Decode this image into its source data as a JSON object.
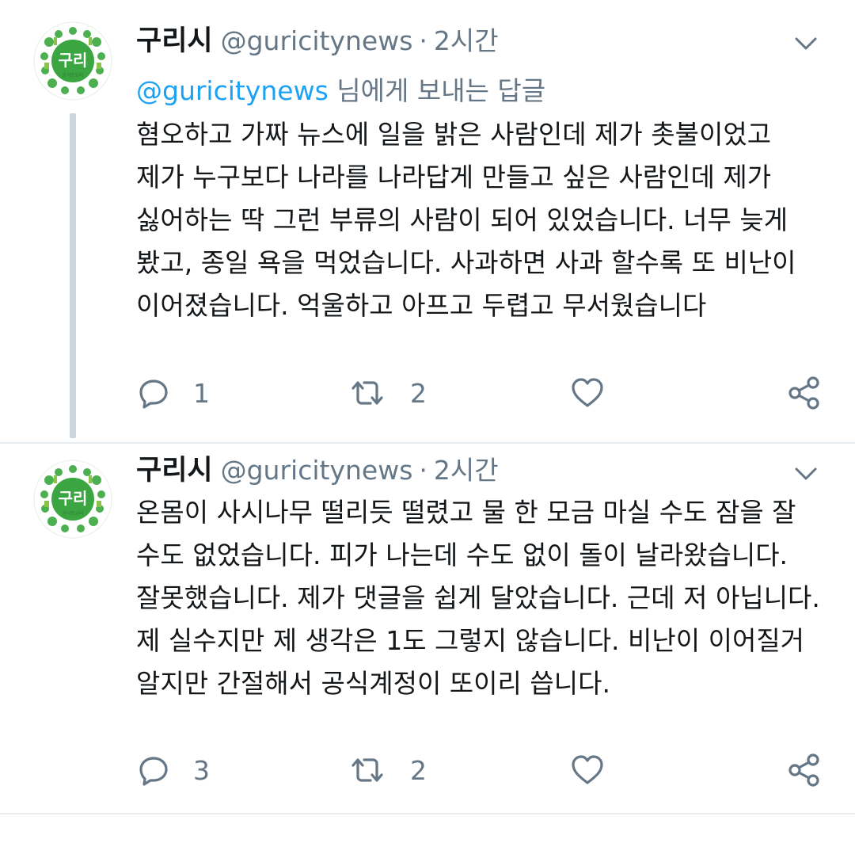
{
  "tweets": [
    {
      "display_name": "구리시",
      "handle": "@guricitynews",
      "separator": "·",
      "time": "2시간",
      "reply_to_mention": "@guricitynews",
      "reply_to_suffix": " 님에게 보내는 답글",
      "text": "혐오하고 가짜 뉴스에 일을 밝은 사람인데 제가 촛불이었고 제가 누구보다 나라를 나라답게 만들고 싶은 사람인데 제가 싫어하는 딱 그런 부류의 사람이 되어 있었습니다. 너무 늦게 봤고, 종일 욕을 먹었습니다. 사과하면 사과 할수록 또 비난이 이어졌습니다. 억울하고 아프고 두렵고 무서웠습니다",
      "reply_count": "1",
      "retweet_count": "2",
      "avatar_text": "구리",
      "avatar_subtext": "공식트위터"
    },
    {
      "display_name": "구리시",
      "handle": "@guricitynews",
      "separator": "·",
      "time": "2시간",
      "text": "온몸이 사시나무 떨리듯 떨렸고 물 한 모금 마실 수도 잠을 잘 수도 없었습니다. 피가 나는데 수도 없이 돌이 날라왔습니다. 잘못했습니다. 제가 댓글을 쉽게 달았습니다. 근데 저 아닙니다. 제 실수지만 제 생각은 1도 그렇지 않습니다. 비난이 이어질거 알지만 간절해서 공식계정이 또이리 씁니다.",
      "reply_count": "3",
      "retweet_count": "2",
      "avatar_text": "구리",
      "avatar_subtext": "공식트위터"
    }
  ],
  "icons": {
    "reply": "reply-icon",
    "retweet": "retweet-icon",
    "like": "heart-icon",
    "share": "share-icon",
    "caret": "chevron-down-icon"
  },
  "colors": {
    "text": "#14171a",
    "secondary": "#657786",
    "link": "#1da1f2",
    "avatar_green": "#3aa541",
    "thread_line": "#cdd6dd"
  }
}
